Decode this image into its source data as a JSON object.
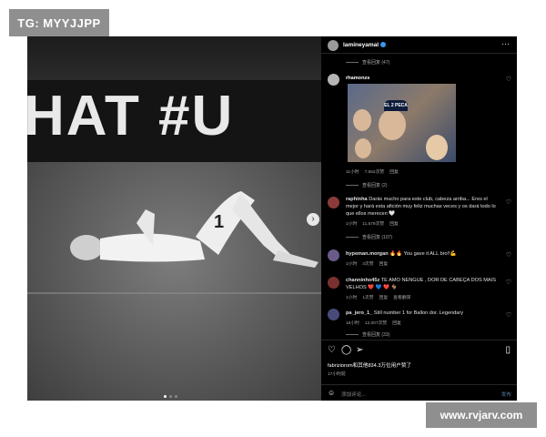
{
  "watermarks": {
    "top_left": "TG: MYYJJPP",
    "bottom_right": "www.rvjarv.com"
  },
  "photo": {
    "banner_text": "HAT #U"
  },
  "post": {
    "author": "lamineyamal",
    "view_replies_47": "查看回复 (47)",
    "comments": [
      {
        "user": "rhamonzs",
        "meta": [
          "11小时",
          "7,552次赞",
          "回复"
        ],
        "replies": "查看回复 (2)",
        "image_caption": "EL 2 PECA"
      },
      {
        "user": "raphinha",
        "text": "Darás mucho para este club, cabeza arriba... Eres el mejor y hará esta afición muy feliz muchas veces y os dará todo lo que ellos merecen 🤍",
        "meta": [
          "1小时",
          "11,579次赞",
          "回复"
        ],
        "replies": "查看回复 (107)"
      },
      {
        "user": "hypeman.morgan",
        "text": "🔥🔥 You gave it ALL bro!!💪",
        "meta": [
          "1小时",
          "3次赞",
          "回复"
        ]
      },
      {
        "user": "channinho45z",
        "text": "TE AMO NENGUE , DOR DE CABEÇA DOS MAIS VELHOS ❤️ 💙 ❤️ 🐐",
        "meta": [
          "1小时",
          "1次赞",
          "回复",
          "查看翻译"
        ]
      },
      {
        "user": "pa_jero_1_",
        "text": "Still number 1 for Ballon dor. Legendary",
        "meta": [
          "16小时",
          "12,007次赞",
          "回复"
        ],
        "replies": "查看回复 (33)"
      }
    ],
    "likes_text": "fabriziorom和其他834.3万位用户赞了",
    "time": "17小时前",
    "add_comment_placeholder": "添加评论...",
    "post_button": "发布"
  },
  "icons": [
    "more-icon",
    "heart-icon",
    "comment-icon",
    "share-icon",
    "save-icon",
    "emoji-icon",
    "next-arrow-icon"
  ]
}
